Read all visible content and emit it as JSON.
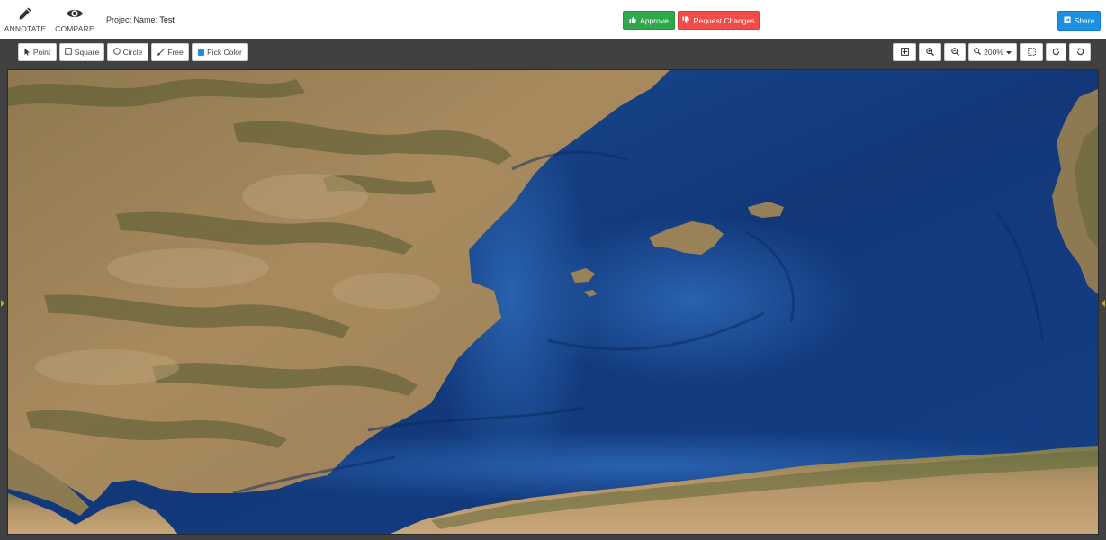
{
  "header": {
    "modes": [
      {
        "label": "ANNOTATE",
        "icon": "pencil-icon"
      },
      {
        "label": "COMPARE",
        "icon": "eye-icon"
      }
    ],
    "project_label": "Project Name:",
    "project_value": "Test",
    "approve_label": "Approve",
    "approve_icon": "thumbs-up-icon",
    "request_changes_label": "Request Changes",
    "request_changes_icon": "thumbs-down-icon",
    "share_label": "Share",
    "share_icon": "share-icon",
    "colors": {
      "approve": "#2ea84a",
      "request_changes": "#f24b48",
      "share": "#1a8fe3"
    }
  },
  "toolbar": {
    "tools": [
      {
        "label": "Point",
        "icon": "cursor-arrow-icon"
      },
      {
        "label": "Square",
        "icon": "square-icon"
      },
      {
        "label": "Circle",
        "icon": "circle-icon"
      },
      {
        "label": "Free",
        "icon": "brush-icon"
      },
      {
        "label": "Pick Color",
        "icon": "color-swatch-icon",
        "color": "#1a8fe3"
      }
    ],
    "view_controls": {
      "fit_icon": "fit-to-screen-icon",
      "zoom_in_icon": "zoom-in-icon",
      "zoom_out_icon": "zoom-out-icon",
      "zoom_level": "200%",
      "zoom_icon": "magnifier-icon",
      "select_area_icon": "dashed-selection-icon",
      "rotate_cw_icon": "rotate-clockwise-icon",
      "rotate_ccw_icon": "rotate-counterclockwise-icon"
    }
  },
  "canvas": {
    "image_subject": "satellite-image-western-mediterranean"
  }
}
